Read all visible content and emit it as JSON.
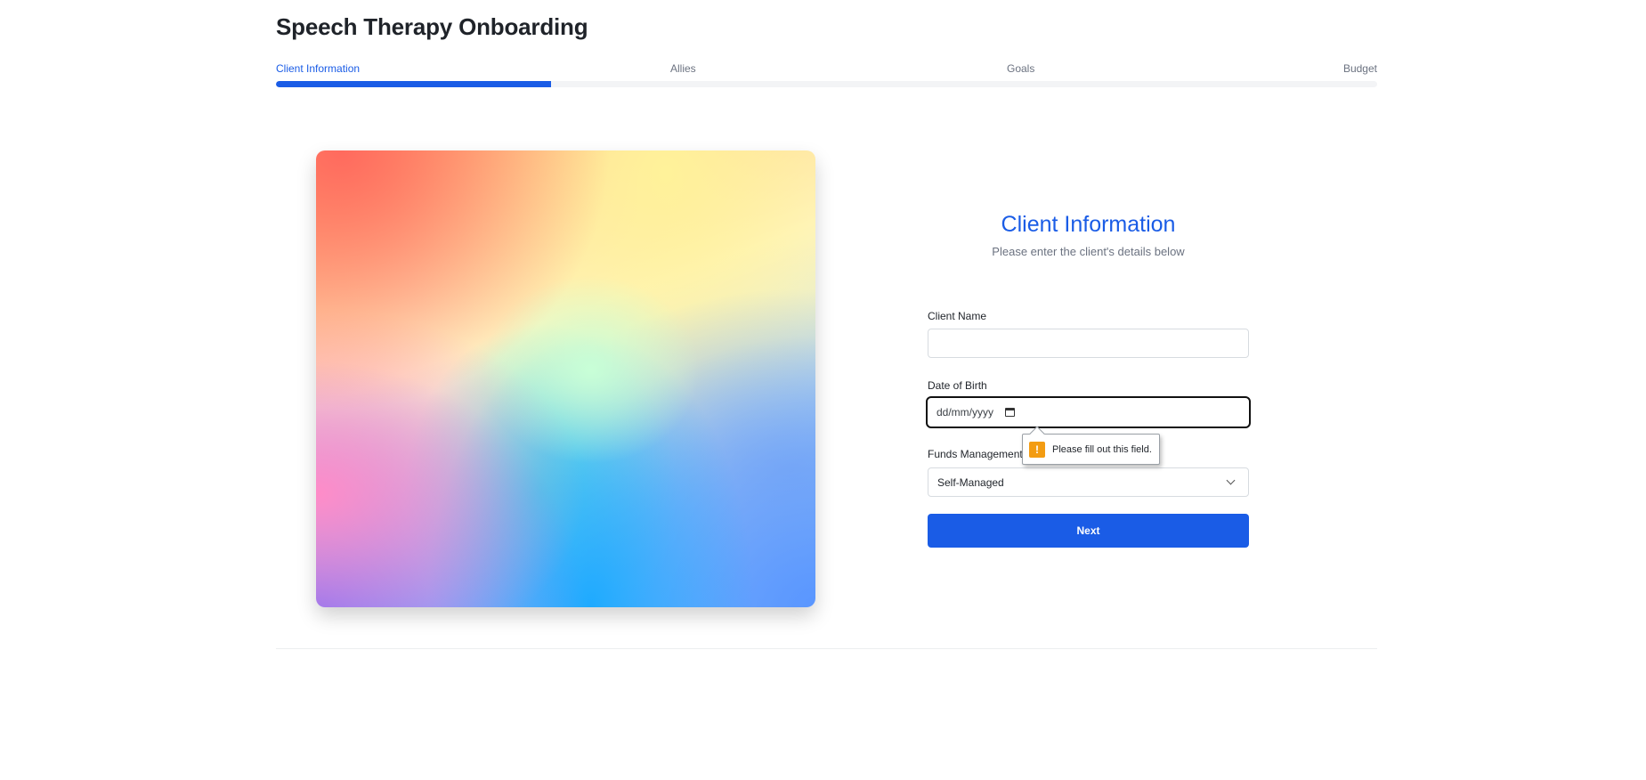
{
  "header": {
    "title": "Speech Therapy Onboarding"
  },
  "stepper": {
    "steps": [
      {
        "label": "Client Information",
        "active": true
      },
      {
        "label": "Allies",
        "active": false
      },
      {
        "label": "Goals",
        "active": false
      },
      {
        "label": "Budget",
        "active": false
      }
    ],
    "progress_fraction": 0.25
  },
  "form": {
    "heading": "Client Information",
    "subheading": "Please enter the client's details below",
    "client_name": {
      "label": "Client Name",
      "value": ""
    },
    "date_of_birth": {
      "label": "Date of Birth",
      "placeholder": "dd/mm/yyyy",
      "icon": "calendar-icon"
    },
    "funds_management": {
      "label": "Funds Management",
      "selected": "Self-Managed",
      "icon": "chevron-down-icon"
    },
    "next_label": "Next"
  },
  "validation_tooltip": {
    "icon": "warning-icon",
    "icon_glyph": "!",
    "message": "Please fill out this field."
  },
  "colors": {
    "accent": "#1a5ce6",
    "warning": "#f39c12"
  }
}
